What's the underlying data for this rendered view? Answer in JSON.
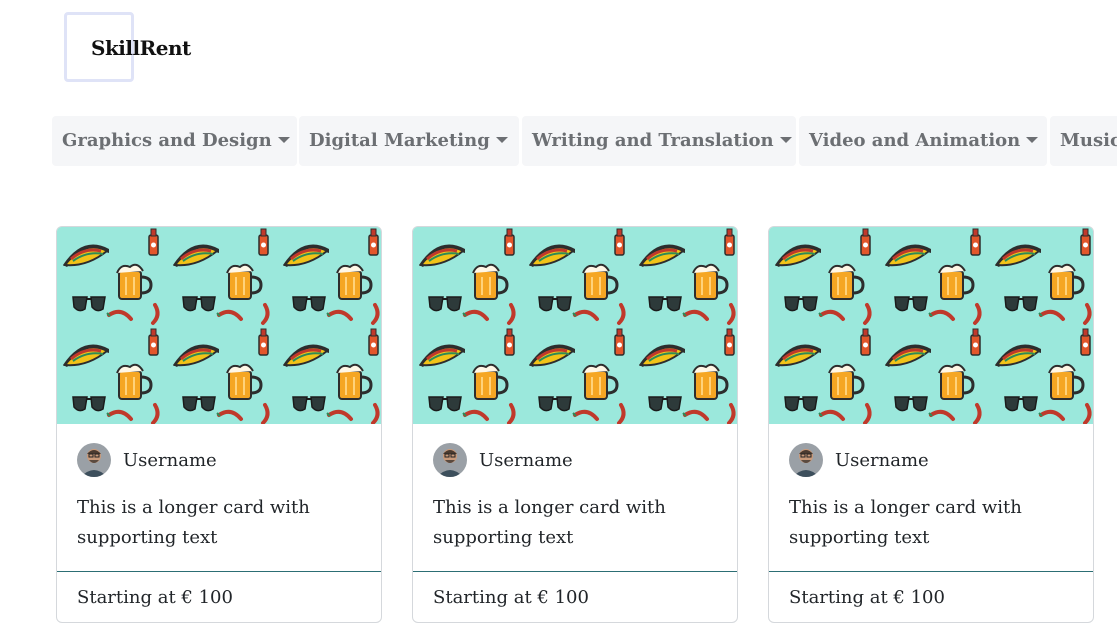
{
  "brand": {
    "name": "SkillRent"
  },
  "nav": {
    "items": [
      {
        "label": "Graphics and Design",
        "has_dropdown": true
      },
      {
        "label": "Digital Marketing",
        "has_dropdown": true
      },
      {
        "label": "Writing and Translation",
        "has_dropdown": true
      },
      {
        "label": "Video and Animation",
        "has_dropdown": true
      },
      {
        "label": "Music",
        "has_dropdown": false
      }
    ]
  },
  "cards": [
    {
      "image": "food-pattern-image",
      "username": "Username",
      "text": "This is a longer card with supporting text",
      "price": "Starting at € 100"
    },
    {
      "image": "food-pattern-image",
      "username": "Username",
      "text": "This is a longer card with supporting text",
      "price": "Starting at € 100"
    },
    {
      "image": "food-pattern-image",
      "username": "Username",
      "text": "This is a longer card with supporting text",
      "price": "Starting at € 100"
    }
  ],
  "colors": {
    "nav_bg": "#f5f6f8",
    "nav_text": "#6c6f73",
    "image_bg": "#9be8dc",
    "footer_border": "#2c6e74",
    "logo_border": "#dfe3f7"
  }
}
